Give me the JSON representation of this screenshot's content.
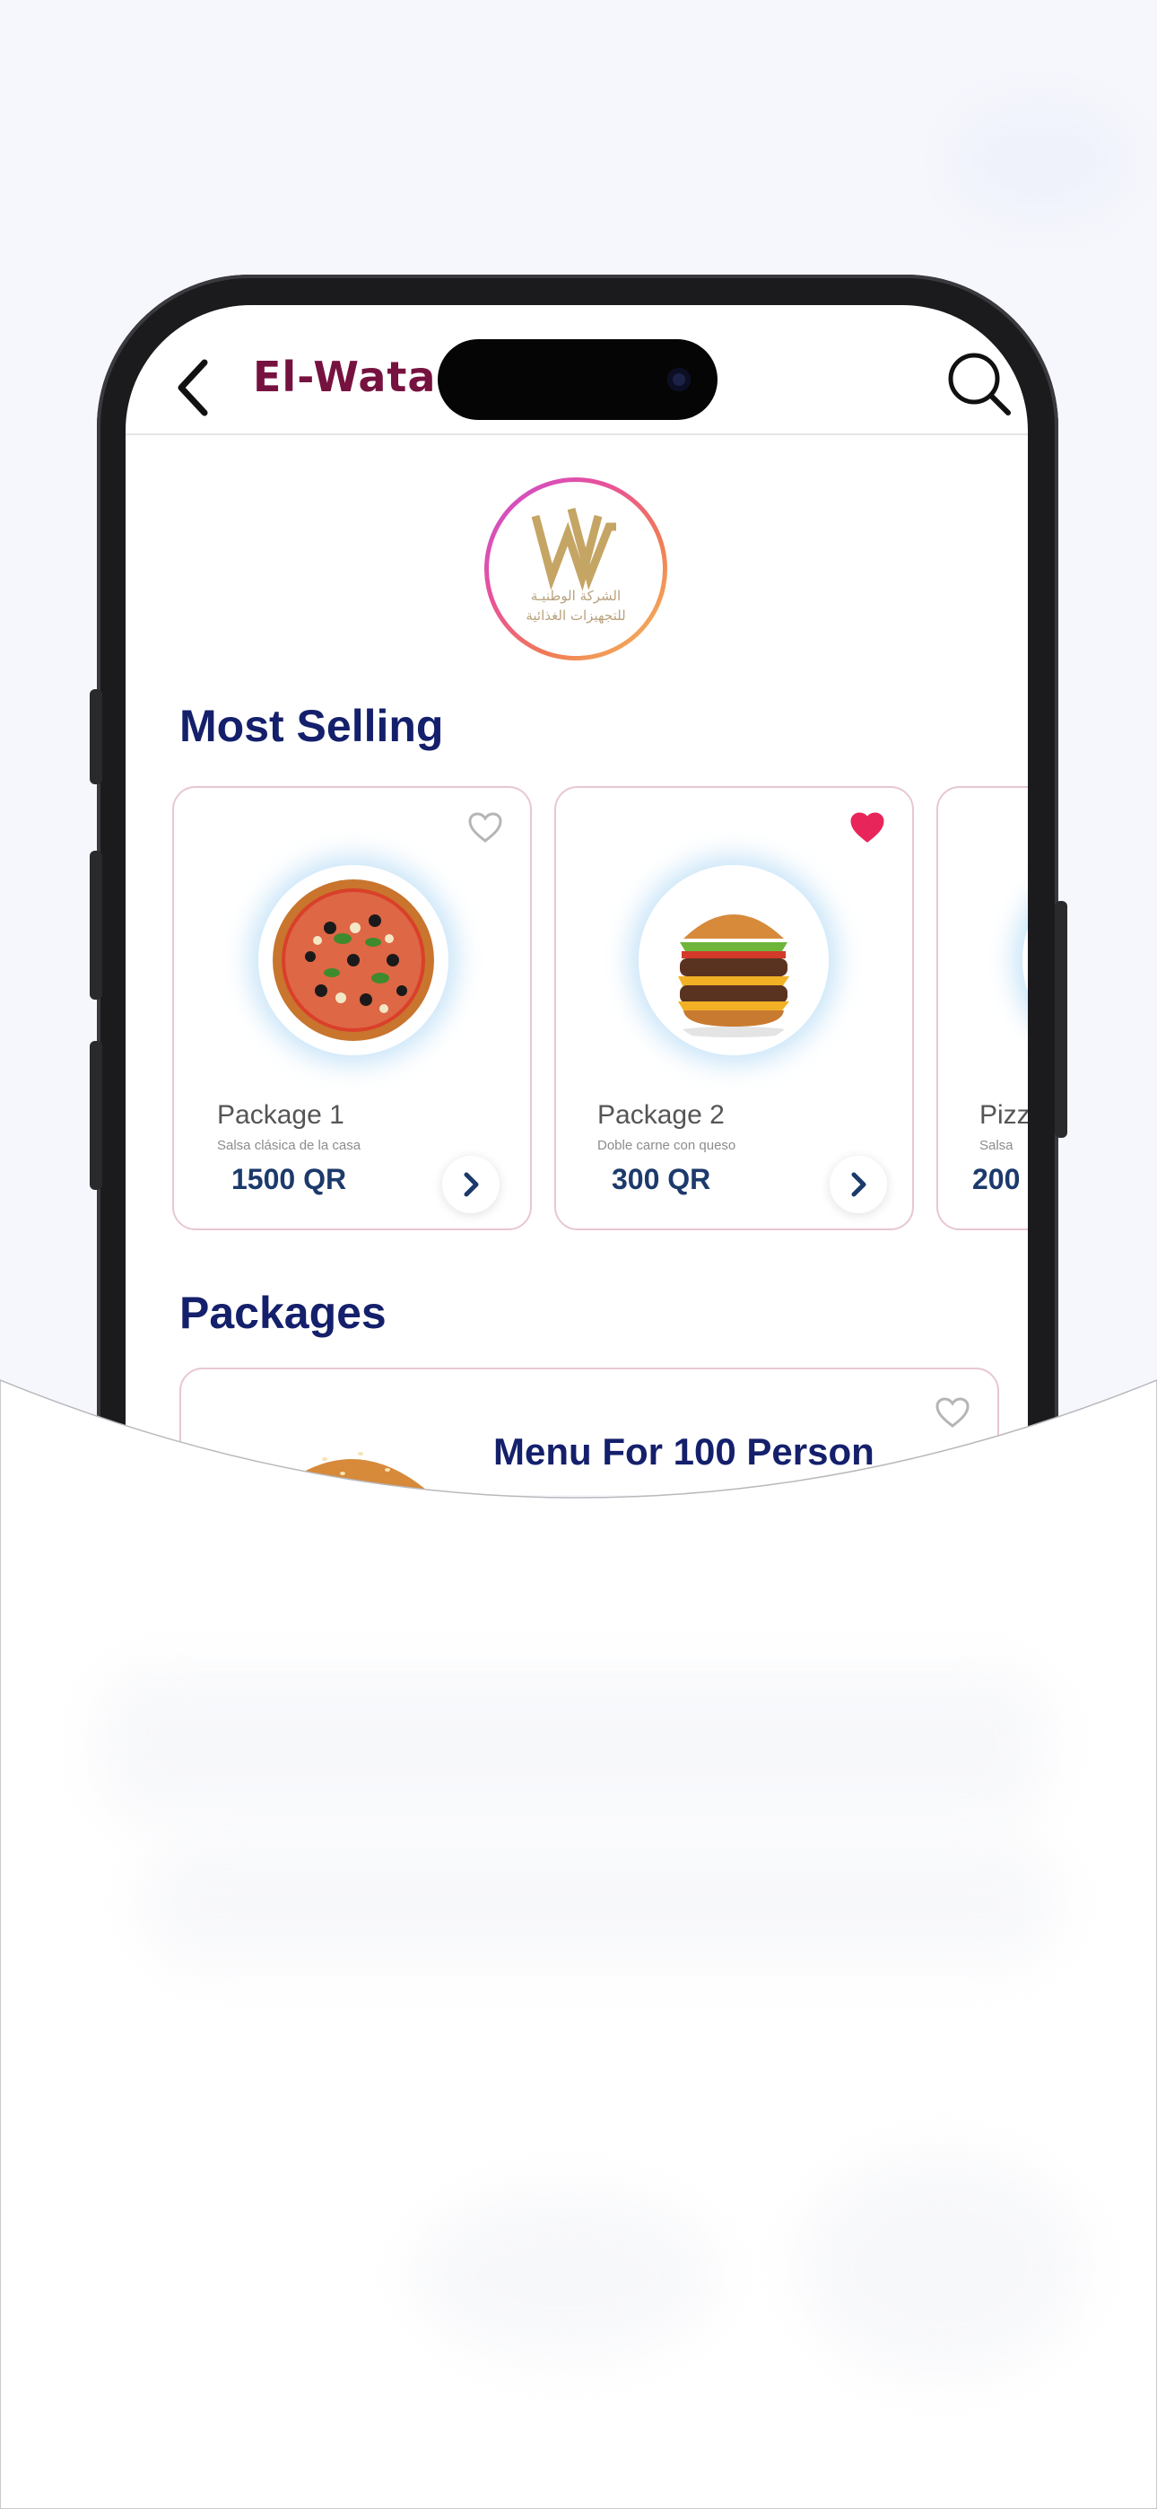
{
  "header": {
    "title": "El-Watan"
  },
  "logo": {
    "line1": "الشركة الوطنيـة",
    "line2": "للتجهيزات الغذائية"
  },
  "sections": {
    "most_selling": "Most Selling",
    "packages": "Packages"
  },
  "products": [
    {
      "name": "Package 1",
      "desc": "Salsa clásica de la casa",
      "price": "1500 QR",
      "favorite": false
    },
    {
      "name": "Package 2",
      "desc": "Doble carne con queso",
      "price": "300 QR",
      "favorite": true
    },
    {
      "name": "Pizza",
      "desc": "Salsa",
      "price": "200",
      "favorite": false
    }
  ],
  "package_item": {
    "title": "Menu For 100 Person",
    "favorite": false
  },
  "colors": {
    "accent": "#76123f",
    "heading": "#14206b",
    "price": "#1c3a6b",
    "fav_active": "#e8255a"
  },
  "icons": [
    "back-arrow-icon",
    "search-icon",
    "heart-icon",
    "chevron-right-icon"
  ]
}
